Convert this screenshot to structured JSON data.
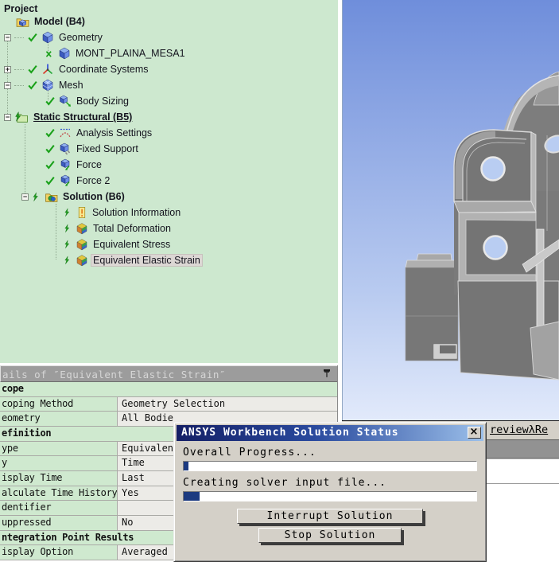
{
  "sym": {
    "minus": "−",
    "plus": "+"
  },
  "tree": {
    "items": [
      {
        "label": "Project"
      },
      {
        "label": "Model (B4)"
      },
      {
        "label": "Geometry"
      },
      {
        "label": "MONT_PLAINA_MESA1"
      },
      {
        "label": "Coordinate Systems"
      },
      {
        "label": "Mesh"
      },
      {
        "label": "Body Sizing"
      },
      {
        "label": "Static Structural (B5)"
      },
      {
        "label": "Analysis Settings"
      },
      {
        "label": "Fixed Support"
      },
      {
        "label": "Force"
      },
      {
        "label": "Force 2"
      },
      {
        "label": "Solution (B6)"
      },
      {
        "label": "Solution Information"
      },
      {
        "label": "Total Deformation"
      },
      {
        "label": "Equivalent Stress"
      },
      {
        "label": "Equivalent Elastic Strain"
      }
    ]
  },
  "details": {
    "title": "ails of ″Equivalent Elastic Strain″",
    "rows": [
      {
        "label": "cope",
        "section": true
      },
      {
        "label": "coping Method",
        "value": "Geometry Selection"
      },
      {
        "label": "eometry",
        "value": "All Bodie"
      },
      {
        "label": "efinition",
        "section": true
      },
      {
        "label": "ype",
        "value": "Equivalen"
      },
      {
        "label": "y",
        "value": "Time"
      },
      {
        "label": "isplay Time",
        "value": "Last"
      },
      {
        "label": "alculate Time History",
        "value": "Yes"
      },
      {
        "label": "dentifier",
        "value": ""
      },
      {
        "label": "uppressed",
        "value": "No"
      },
      {
        "label": "ntegration Point Results",
        "section": true
      },
      {
        "label": "isplay Option",
        "value": "Averaged"
      }
    ]
  },
  "viewport": {
    "tab_text": "reviewλRe"
  },
  "dialog": {
    "title": "ANSYS Workbench Solution Status",
    "close": "×",
    "progress1_label": "Overall Progress...",
    "progress1_percent": 1.6,
    "progress2_label": "Creating solver input file...",
    "progress2_percent": 5.5,
    "interrupt_label": "Interrupt Solution",
    "stop_label": "Stop Solution"
  },
  "colors": {
    "tree_bg": "#cde8cf",
    "details_label_bg": "#cfe9cf",
    "details_value_bg": "#ecebe7",
    "titlebar_gray": "#9c9c9c",
    "dialog_bg": "#d4d0c8",
    "dialog_title_navy": "#141f66",
    "progress_fill": "#1c3a80",
    "viewport_top": "#6f8edb",
    "viewport_bottom": "#e2eafb",
    "model_gray": "#767676",
    "check_green": "#1aa11a"
  }
}
